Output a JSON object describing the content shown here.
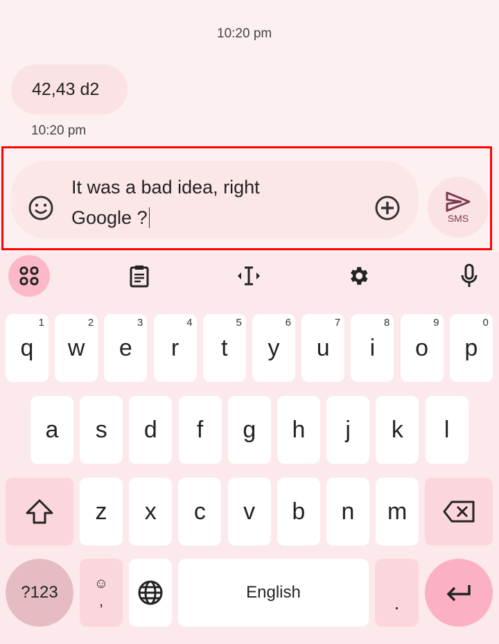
{
  "messages": [
    {
      "text": "42,43 d2",
      "time": "10:20 pm"
    }
  ],
  "header_time": "10:20 pm",
  "compose": {
    "text_line1": "It was a bad idea, right",
    "text_line2": "Google ?",
    "send_label": "SMS"
  },
  "toolbar": [
    "apps-icon",
    "clipboard-icon",
    "cursor-move-icon",
    "settings-icon",
    "microphone-icon"
  ],
  "keyboard": {
    "row1": [
      [
        "q",
        "1"
      ],
      [
        "w",
        "2"
      ],
      [
        "e",
        "3"
      ],
      [
        "r",
        "4"
      ],
      [
        "t",
        "5"
      ],
      [
        "y",
        "6"
      ],
      [
        "u",
        "7"
      ],
      [
        "i",
        "8"
      ],
      [
        "o",
        "9"
      ],
      [
        "p",
        "0"
      ]
    ],
    "row2": [
      "a",
      "s",
      "d",
      "f",
      "g",
      "h",
      "j",
      "k",
      "l"
    ],
    "row3": [
      "z",
      "x",
      "c",
      "v",
      "b",
      "n",
      "m"
    ],
    "symbols_label": "?123",
    "comma_label": ",",
    "space_label": "English",
    "period_label": "."
  },
  "colors": {
    "accent": "#fbb0c4",
    "highlight": "#ff0000",
    "send": "#7b3a52"
  }
}
